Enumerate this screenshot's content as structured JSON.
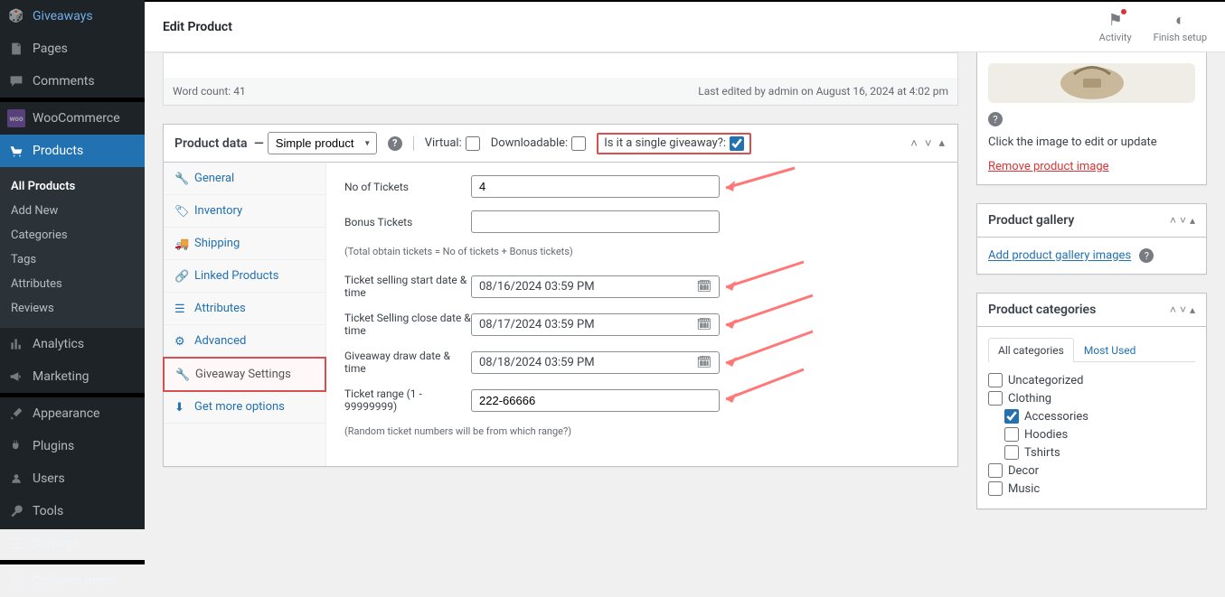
{
  "header": {
    "title": "Edit Product",
    "activity": "Activity",
    "finish": "Finish setup"
  },
  "sidebar": {
    "items": [
      "Giveaways",
      "Pages",
      "Comments",
      "WooCommerce",
      "Products",
      "Analytics",
      "Marketing",
      "Appearance",
      "Plugins",
      "Users",
      "Tools",
      "Settings",
      "Collapse menu"
    ],
    "products_sub": [
      "All Products",
      "Add New",
      "Categories",
      "Tags",
      "Attributes",
      "Reviews"
    ]
  },
  "editor": {
    "wordcount_label": "Word count:",
    "wordcount": "41",
    "last_edited": "Last edited by admin on August 16, 2024 at 4:02 pm"
  },
  "pdata": {
    "title": "Product data",
    "type": "Simple product",
    "virtual": "Virtual:",
    "downloadable": "Downloadable:",
    "single_giveaway": "Is it a single giveaway?:",
    "tabs": [
      "General",
      "Inventory",
      "Shipping",
      "Linked Products",
      "Attributes",
      "Advanced",
      "Giveaway Settings",
      "Get more options"
    ],
    "fields": {
      "no_tickets": {
        "label": "No of Tickets",
        "value": "4"
      },
      "bonus": {
        "label": "Bonus Tickets",
        "value": ""
      },
      "total_hint": "(Total obtain tickets = No of tickets + Bonus tickets)",
      "start": {
        "label": "Ticket selling start date & time",
        "value": "08/16/2024 03:59 PM"
      },
      "close": {
        "label": "Ticket Selling close date & time",
        "value": "08/17/2024 03:59 PM"
      },
      "draw": {
        "label": "Giveaway draw date & time",
        "value": "08/18/2024 03:59 PM"
      },
      "range": {
        "label": "Ticket range (1 - 99999999)",
        "value": "222-66666"
      },
      "range_hint": "(Random ticket numbers will be from which range?)"
    }
  },
  "rside": {
    "image": {
      "click_hint": "Click the image to edit or update",
      "remove": "Remove product image"
    },
    "gallery": {
      "title": "Product gallery",
      "add": "Add product gallery images"
    },
    "categories": {
      "title": "Product categories",
      "tab_all": "All categories",
      "tab_most": "Most Used",
      "items": {
        "uncategorized": "Uncategorized",
        "clothing": "Clothing",
        "accessories": "Accessories",
        "hoodies": "Hoodies",
        "tshirts": "Tshirts",
        "decor": "Decor",
        "music": "Music"
      }
    }
  }
}
